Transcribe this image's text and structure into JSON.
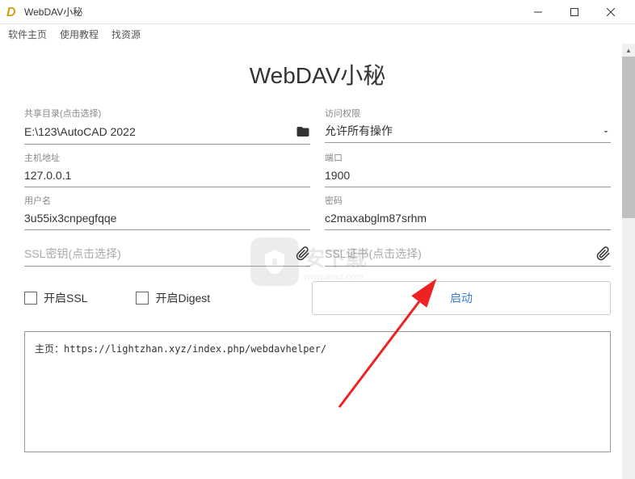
{
  "window": {
    "title": "WebDAV小秘"
  },
  "menu": {
    "home": "软件主页",
    "tutorial": "使用教程",
    "resources": "找资源"
  },
  "page": {
    "title": "WebDAV小秘"
  },
  "form": {
    "shareDir": {
      "label": "共享目录(点击选择)",
      "value": "E:\\123\\AutoCAD 2022"
    },
    "accessPerm": {
      "label": "访问权限",
      "value": "允许所有操作"
    },
    "host": {
      "label": "主机地址",
      "value": "127.0.0.1"
    },
    "port": {
      "label": "端口",
      "value": "1900"
    },
    "username": {
      "label": "用户名",
      "value": "3u55ix3cnpegfqqe"
    },
    "password": {
      "label": "密码",
      "value": "c2maxabglm87srhm"
    },
    "sslKey": {
      "label": "",
      "placeholder": "SSL密钥(点击选择)"
    },
    "sslCert": {
      "label": "",
      "placeholder": "SSL证书(点击选择)"
    }
  },
  "checkboxes": {
    "ssl": "开启SSL",
    "digest": "开启Digest"
  },
  "buttons": {
    "start": "启动"
  },
  "log": {
    "line1": "主页：https://lightzhan.xyz/index.php/webdavhelper/"
  },
  "watermark": {
    "text": "安下载",
    "url": "www.anxz.com"
  }
}
